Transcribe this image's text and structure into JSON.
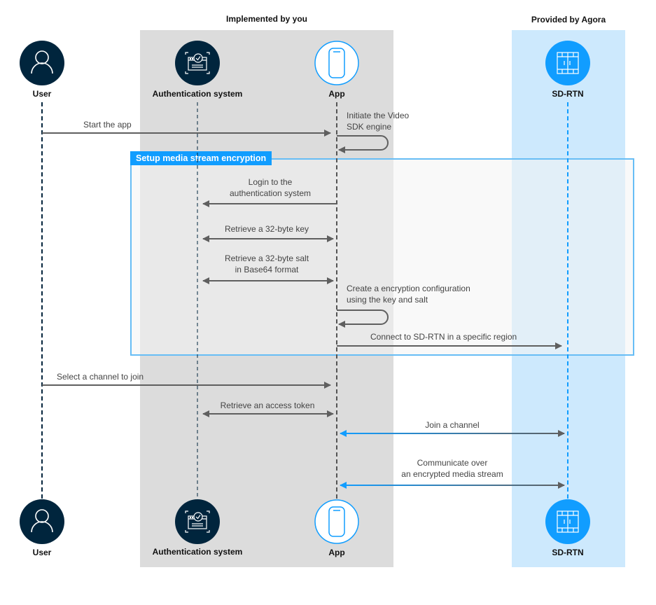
{
  "groups": {
    "implemented_by_you": "Implemented by you",
    "provided_by_agora": "Provided by Agora"
  },
  "actors": {
    "user": {
      "label": "User",
      "icon": "user-icon"
    },
    "auth": {
      "label": "Authentication system",
      "icon": "authentication-screen-icon"
    },
    "app": {
      "label": "App",
      "icon": "smartphone-icon"
    },
    "sdrtn": {
      "label": "SD-RTN",
      "icon": "server-rack-icon"
    }
  },
  "encryption_section": {
    "label": "Setup media stream encryption"
  },
  "messages": {
    "start_app": {
      "line1": "Start the app",
      "from": "User",
      "to": "App"
    },
    "init_engine": {
      "line1": "Initiate the Video",
      "line2": "SDK engine",
      "from": "App",
      "to": "App"
    },
    "login": {
      "line1": "Login to the",
      "line2": "authentication system",
      "from": "App",
      "to": "Authentication system"
    },
    "retrieve_key": {
      "line1": "Retrieve a 32-byte key",
      "direction": "bidirectional"
    },
    "retrieve_salt": {
      "line1": "Retrieve a 32-byte salt",
      "line2": "in Base64 format",
      "direction": "bidirectional"
    },
    "create_config": {
      "line1": "Create a encryption configuration",
      "line2": "using the key and salt",
      "from": "App",
      "to": "App"
    },
    "connect_sdrtn": {
      "line1": "Connect to SD-RTN in a specific region",
      "from": "App",
      "to": "SD-RTN"
    },
    "select_channel": {
      "line1": "Select a channel to join",
      "from": "User",
      "to": "App"
    },
    "retrieve_token": {
      "line1": "Retrieve an access token",
      "direction": "bidirectional"
    },
    "join_channel": {
      "line1": "Join a channel",
      "direction": "bidirectional"
    },
    "communicate": {
      "line1": "Communicate over",
      "line2": "an encrypted media stream",
      "direction": "bidirectional"
    }
  },
  "colors": {
    "navy": "#00253d",
    "agora_blue": "#119dff",
    "arrow_gray": "#5f5f5f",
    "panel_gray": "#dcdcdc",
    "panel_blue": "#cde9fd"
  }
}
